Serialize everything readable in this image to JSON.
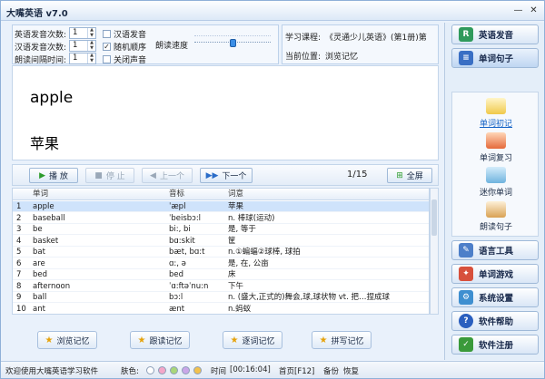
{
  "window": {
    "title": "大嘴英语 v7.0",
    "minimize": "—",
    "close": "✕"
  },
  "settings": {
    "en_times_label": "英语发音次数:",
    "en_times_value": "1",
    "cn_times_label": "汉语发音次数:",
    "cn_times_value": "1",
    "interval_label": "朗读间隔时间:",
    "interval_value": "1",
    "chk_cn_voice": "汉语发音",
    "chk_cn_voice_checked": false,
    "chk_random": "随机顺序",
    "chk_random_checked": true,
    "chk_mute": "关闭声音",
    "chk_mute_checked": false,
    "speed_label": "朗读速度",
    "speed_level": 0.5
  },
  "course": {
    "label": "学习课程:",
    "value": "《灵通少儿英语》(第1册)第",
    "position_label": "当前位置:",
    "position_value": "浏览记忆"
  },
  "card": {
    "word": "apple",
    "meaning": "苹果"
  },
  "toolbar": {
    "play": "播 放",
    "stop": "停 止",
    "prev": "上一个",
    "next": "下一个",
    "counter": "1/15",
    "fullscreen": "全屏"
  },
  "table": {
    "headers": {
      "word": "单词",
      "phonetic": "音标",
      "meaning": "词意"
    },
    "rows": [
      {
        "num": "1",
        "word": "apple",
        "phonetic": "ˈæpl",
        "meaning": "苹果",
        "selected": true
      },
      {
        "num": "2",
        "word": "baseball",
        "phonetic": "ˈbeisbɔ:l",
        "meaning": "n. 棒球(运动)"
      },
      {
        "num": "3",
        "word": "be",
        "phonetic": "bi:, bi",
        "meaning": "是, 等于"
      },
      {
        "num": "4",
        "word": "basket",
        "phonetic": "bɑ:skit",
        "meaning": "筐"
      },
      {
        "num": "5",
        "word": "bat",
        "phonetic": "bæt, bɑ:t",
        "meaning": "n.①蝙蝠②球棒, 球拍"
      },
      {
        "num": "6",
        "word": "are",
        "phonetic": "ɑ:, ə",
        "meaning": "是, 在, 公亩"
      },
      {
        "num": "7",
        "word": "bed",
        "phonetic": "bed",
        "meaning": "床"
      },
      {
        "num": "8",
        "word": "afternoon",
        "phonetic": "ˈɑ:ftəˈnu:n",
        "meaning": "下午"
      },
      {
        "num": "9",
        "word": "ball",
        "phonetic": "bɔ:l",
        "meaning": "n. (盛大,正式的)舞会,球,球状物 vt. 把…捏成球"
      },
      {
        "num": "10",
        "word": "ant",
        "phonetic": "ænt",
        "meaning": "n.蚂蚁"
      }
    ]
  },
  "modes": {
    "browse": "浏览记忆",
    "follow": "跟读记忆",
    "listen": "逐词记忆",
    "spell": "拼写记忆"
  },
  "status": {
    "welcome": "欢迎使用大嘴英语学习软件",
    "skin_label": "肤色:",
    "skin_colors": [
      "#ffffff",
      "#f4a6c8",
      "#a9d67a",
      "#c9a6e8",
      "#f2c14e"
    ],
    "time_label": "时间",
    "time_value": "[00:16:04]",
    "home": "首页[F12]",
    "backup": "备份",
    "restore": "恢复"
  },
  "sidebar": {
    "english_voice": "英语发音",
    "word_sentence": "单词句子",
    "sub_items": [
      "单词初记",
      "单词复习",
      "迷你单词",
      "朗读句子"
    ],
    "language_tools": "语言工具",
    "word_games": "单词游戏",
    "settings": "系统设置",
    "help": "软件帮助",
    "register": "软件注册"
  }
}
